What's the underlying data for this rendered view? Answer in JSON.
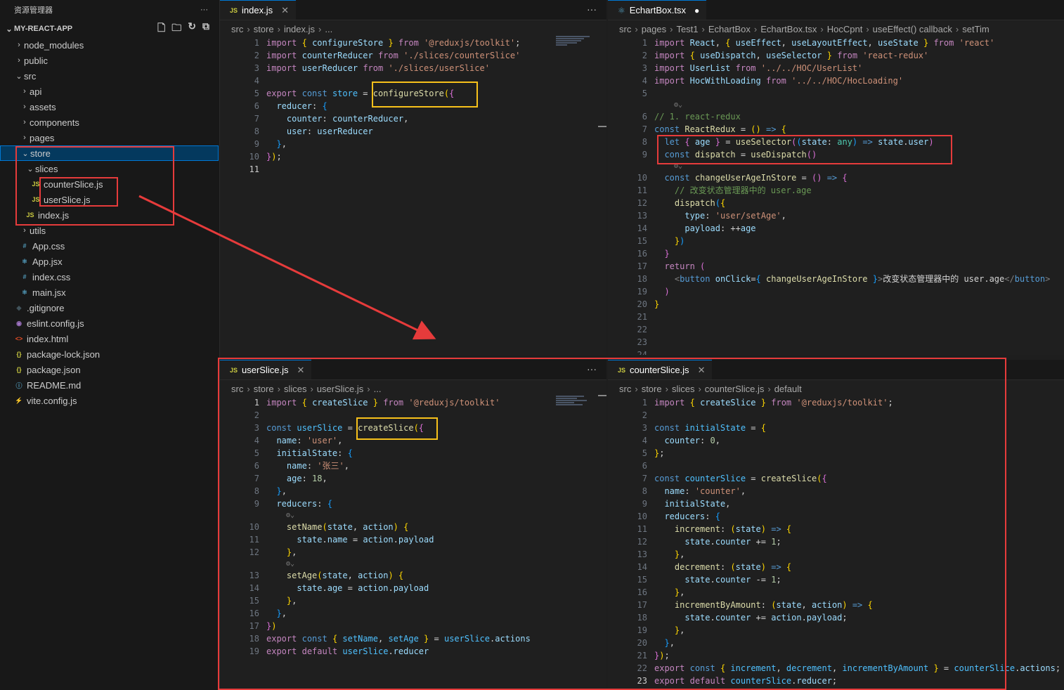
{
  "explorer": {
    "title": "资源管理器",
    "more": "···",
    "project": "MY-REACT-APP",
    "tree": [
      {
        "name": "node_modules",
        "type": "folder",
        "open": false,
        "depth": 1
      },
      {
        "name": "public",
        "type": "folder",
        "open": false,
        "depth": 1
      },
      {
        "name": "src",
        "type": "folder",
        "open": true,
        "depth": 1
      },
      {
        "name": "api",
        "type": "folder",
        "open": false,
        "depth": 2
      },
      {
        "name": "assets",
        "type": "folder",
        "open": false,
        "depth": 2
      },
      {
        "name": "components",
        "type": "folder",
        "open": false,
        "depth": 2
      },
      {
        "name": "pages",
        "type": "folder",
        "open": false,
        "depth": 2
      },
      {
        "name": "store",
        "type": "folder",
        "open": true,
        "depth": 2,
        "selected": true
      },
      {
        "name": "slices",
        "type": "folder",
        "open": true,
        "depth": 3
      },
      {
        "name": "counterSlice.js",
        "type": "js",
        "depth": 4
      },
      {
        "name": "userSlice.js",
        "type": "js",
        "depth": 4
      },
      {
        "name": "index.js",
        "type": "js",
        "depth": 3
      },
      {
        "name": "utils",
        "type": "folder",
        "open": false,
        "depth": 2
      },
      {
        "name": "App.css",
        "type": "css",
        "depth": 2
      },
      {
        "name": "App.jsx",
        "type": "react",
        "depth": 2
      },
      {
        "name": "index.css",
        "type": "css",
        "depth": 2
      },
      {
        "name": "main.jsx",
        "type": "react",
        "depth": 2
      },
      {
        "name": ".gitignore",
        "type": "git",
        "depth": 1
      },
      {
        "name": "eslint.config.js",
        "type": "eslint",
        "depth": 1
      },
      {
        "name": "index.html",
        "type": "html",
        "depth": 1
      },
      {
        "name": "package-lock.json",
        "type": "json",
        "depth": 1
      },
      {
        "name": "package.json",
        "type": "json",
        "depth": 1
      },
      {
        "name": "README.md",
        "type": "info",
        "depth": 1
      },
      {
        "name": "vite.config.js",
        "type": "vite",
        "depth": 1
      }
    ]
  },
  "panes": {
    "index": {
      "tab": "index.js",
      "breadcrumb": [
        "src",
        "store",
        "index.js",
        "..."
      ],
      "lines": [
        "import { configureStore } from '@reduxjs/toolkit';",
        "import counterReducer from './slices/counterSlice'",
        "import userReducer from './slices/userSlice'",
        "",
        "export const store = configureStore({",
        "  reducer: {",
        "    counter: counterReducer,",
        "    user: userReducer",
        "  },",
        "});",
        ""
      ]
    },
    "echart": {
      "tab": "EchartBox.tsx",
      "breadcrumb": [
        "src",
        "pages",
        "Test1",
        "EchartBox",
        "EchartBox.tsx",
        "HocCpnt",
        "useEffect() callback",
        "setTim"
      ],
      "lines": [
        "import React, { useEffect, useLayoutEffect, useState } from 'react'",
        "import { useDispatch, useSelector } from 'react-redux'",
        "import UserList from '../../HOC/UserList'",
        "import HocWithLoading from '../../HOC/HocLoading'",
        "",
        "// 1. react-redux",
        "const ReactRedux = () => {",
        "  let { age } = useSelector((state: any) => state.user)",
        "  const dispatch = useDispatch()",
        "  const changeUserAgeInStore = () => {",
        "    // 改变状态管理器中的 user.age",
        "    dispatch({",
        "      type: 'user/setAge',",
        "      payload: ++age",
        "    })",
        "  }",
        "  return (",
        "    <button onClick={ changeUserAgeInStore }>改变状态管理器中的 user.age</button>",
        "  )",
        "}",
        "",
        "",
        "",
        ""
      ]
    },
    "user": {
      "tab": "userSlice.js",
      "breadcrumb": [
        "src",
        "store",
        "slices",
        "userSlice.js",
        "..."
      ],
      "lines": [
        "import { createSlice } from '@reduxjs/toolkit'",
        "",
        "const userSlice = createSlice({",
        "  name: 'user',",
        "  initialState: {",
        "    name: '张三',",
        "    age: 18,",
        "  },",
        "  reducers: {",
        "    setName(state, action) {",
        "      state.name = action.payload",
        "    },",
        "    setAge(state, action) {",
        "      state.age = action.payload",
        "    },",
        "  },",
        "})",
        "export const { setName, setAge } = userSlice.actions",
        "export default userSlice.reducer"
      ]
    },
    "counter": {
      "tab": "counterSlice.js",
      "breadcrumb": [
        "src",
        "store",
        "slices",
        "counterSlice.js",
        "default"
      ],
      "lines": [
        "import { createSlice } from '@reduxjs/toolkit';",
        "",
        "const initialState = {",
        "  counter: 0,",
        "};",
        "",
        "const counterSlice = createSlice({",
        "  name: 'counter',",
        "  initialState,",
        "  reducers: {",
        "    increment: (state) => {",
        "      state.counter += 1;",
        "    },",
        "    decrement: (state) => {",
        "      state.counter -= 1;",
        "    },",
        "    incrementByAmount: (state, action) => {",
        "      state.counter += action.payload;",
        "    },",
        "  },",
        "});",
        "export const { increment, decrement, incrementByAmount } = counterSlice.actions;",
        "export default counterSlice.reducer;"
      ]
    }
  },
  "colors": {
    "annotation_red": "#e63b3b",
    "annotation_yellow": "#f7c11b",
    "selection": "#04395e"
  }
}
